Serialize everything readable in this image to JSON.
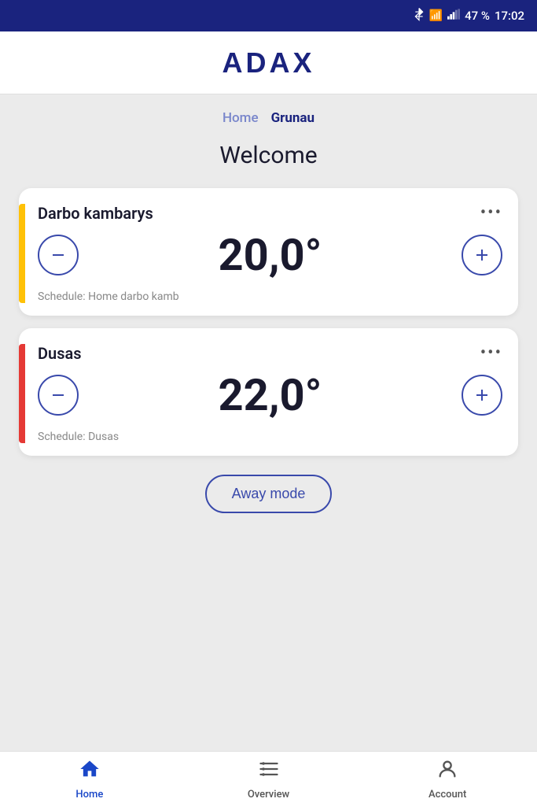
{
  "statusBar": {
    "battery": "47 %",
    "time": "17:02",
    "icons": [
      "bluetooth",
      "wifi",
      "signal",
      "battery"
    ]
  },
  "header": {
    "logo": "ADAX"
  },
  "breadcrumb": {
    "items": [
      {
        "label": "Home",
        "active": false
      },
      {
        "label": "Grunau",
        "active": true
      }
    ]
  },
  "welcome": {
    "title": "Welcome"
  },
  "devices": [
    {
      "id": "darbo",
      "name": "Darbo kambarys",
      "temperature": "20,0°",
      "schedule": "Schedule: Home darbo kamb",
      "accentColor": "yellow"
    },
    {
      "id": "dusas",
      "name": "Dusas",
      "temperature": "22,0°",
      "schedule": "Schedule: Dusas",
      "accentColor": "orange"
    }
  ],
  "awayModeButton": {
    "label": "Away mode"
  },
  "bottomNav": {
    "items": [
      {
        "id": "home",
        "label": "Home",
        "active": true
      },
      {
        "id": "overview",
        "label": "Overview",
        "active": false
      },
      {
        "id": "account",
        "label": "Account",
        "active": false
      }
    ]
  }
}
